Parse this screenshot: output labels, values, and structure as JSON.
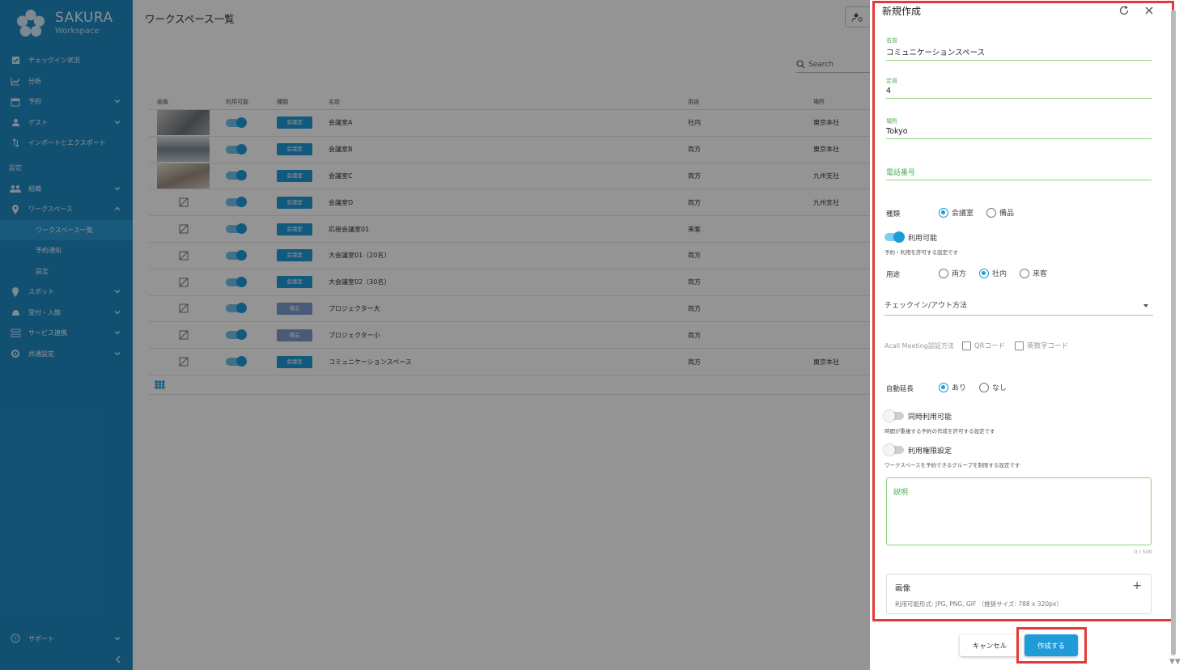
{
  "brand": {
    "name": "SAKURA",
    "sub": "Workspace"
  },
  "sidebar": {
    "items": [
      {
        "label": "チェックイン状況",
        "icon": "checkbox-icon"
      },
      {
        "label": "分析",
        "icon": "chart-icon"
      },
      {
        "label": "予約",
        "icon": "calendar-icon"
      },
      {
        "label": "ゲスト",
        "icon": "person-icon"
      },
      {
        "label": "インポートとエクスポート",
        "icon": "import-export-icon"
      }
    ],
    "section_label": "設定",
    "settings": [
      {
        "label": "組織",
        "icon": "group-icon"
      },
      {
        "label": "ワークスペース",
        "icon": "pin-icon"
      }
    ],
    "sub_items": [
      "ワークスペース一覧",
      "予約通知",
      "設定"
    ],
    "more": [
      {
        "label": "スポット",
        "icon": "spot-icon"
      },
      {
        "label": "受付・入館",
        "icon": "reception-icon"
      },
      {
        "label": "サービス連携",
        "icon": "integration-icon"
      },
      {
        "label": "共通設定",
        "icon": "settings-icon"
      }
    ],
    "support": "サポート"
  },
  "main": {
    "title": "ワークスペース一覧",
    "search_placeholder": "Search",
    "headers": [
      "画像",
      "利用可能",
      "種類",
      "名前",
      "用途",
      "場所"
    ],
    "rows": [
      {
        "type": "会議室",
        "name": "会議室A",
        "use": "社内",
        "loc": "東京本社"
      },
      {
        "type": "会議室",
        "name": "会議室B",
        "use": "両方",
        "loc": "東京本社"
      },
      {
        "type": "会議室",
        "name": "会議室C",
        "use": "両方",
        "loc": "九州支社"
      },
      {
        "type": "会議室",
        "name": "会議室D",
        "use": "両方",
        "loc": "九州支社"
      },
      {
        "type": "会議室",
        "name": "応接会議室01",
        "use": "来客",
        "loc": ""
      },
      {
        "type": "会議室",
        "name": "大会議室01（20名）",
        "use": "両方",
        "loc": ""
      },
      {
        "type": "会議室",
        "name": "大会議室02（30名）",
        "use": "両方",
        "loc": ""
      },
      {
        "type": "備品",
        "name": "プロジェクター大",
        "use": "両方",
        "loc": ""
      },
      {
        "type": "備品",
        "name": "プロジェクター小",
        "use": "両方",
        "loc": ""
      },
      {
        "type": "会議室",
        "name": "コミュニケーションスペース",
        "use": "両方",
        "loc": "東京本社"
      }
    ]
  },
  "drawer": {
    "title": "新規作成",
    "name_label": "名前",
    "name_value": "コミュニケーションスペース",
    "capacity_label": "定員",
    "capacity_value": "4",
    "location_label": "場所",
    "location_value": "Tokyo",
    "phone_placeholder": "電話番号",
    "type_label": "種類",
    "type_opt1": "会議室",
    "type_opt2": "備品",
    "available_label": "利用可能",
    "available_helper": "予約・利用を許可する設定です",
    "use_label": "用途",
    "use_opt1": "両方",
    "use_opt2": "社内",
    "use_opt3": "来客",
    "checkin_select": "チェックイン/アウト方法",
    "acall_label": "Acall Meeting認証方法",
    "acall_opt1": "QRコード",
    "acall_opt2": "英数字コード",
    "auto_label": "自動延長",
    "auto_opt1": "あり",
    "auto_opt2": "なし",
    "concurrent_label": "同時利用可能",
    "concurrent_helper": "時間が重複する予約の作成を許可する設定です",
    "permission_label": "利用権限設定",
    "permission_helper": "ワークスペースを予約できるグループを制限する設定です",
    "desc_placeholder": "説明",
    "desc_counter": "0 / 500",
    "image_title": "画像",
    "image_hint": "利用可能形式: JPG, PNG, GIF （推奨サイズ: 788 x 320px）",
    "cancel": "キャンセル",
    "create": "作成する"
  },
  "colors": {
    "primary": "#1f9bd8",
    "sidebar": "#1f8bc4",
    "field_green": "#4caf50",
    "highlight": "#e53935"
  }
}
